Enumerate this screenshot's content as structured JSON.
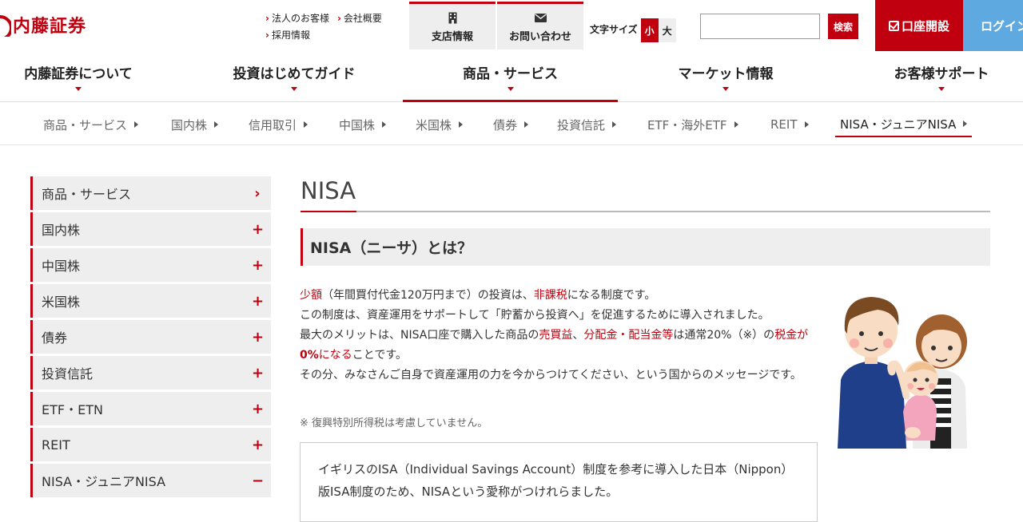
{
  "brand": {
    "name": "内藤証券"
  },
  "header": {
    "links": [
      "法人のお客様",
      "会社概要",
      "採用情報"
    ],
    "branch_label": "支店情報",
    "contact_label": "お問い合わせ",
    "font_size_label": "文字サイズ",
    "font_small": "小",
    "font_large": "大",
    "search_value": "",
    "search_button": "検索",
    "open_account": "口座開設",
    "login": "ログイン"
  },
  "gnav": {
    "items": [
      "内藤証券について",
      "投資はじめてガイド",
      "商品・サービス",
      "マーケット情報",
      "お客様サポート"
    ],
    "active": "商品・サービス"
  },
  "subnav": {
    "items": [
      "商品・サービス",
      "国内株",
      "信用取引",
      "中国株",
      "米国株",
      "債券",
      "投資信託",
      "ETF・海外ETF",
      "REIT",
      "NISA・ジュニアNISA"
    ],
    "active": "NISA・ジュニアNISA"
  },
  "sidebar": {
    "items": [
      {
        "label": "商品・サービス",
        "symbol": "›"
      },
      {
        "label": "国内株",
        "symbol": "+"
      },
      {
        "label": "中国株",
        "symbol": "+"
      },
      {
        "label": "米国株",
        "symbol": "+"
      },
      {
        "label": "債券",
        "symbol": "+"
      },
      {
        "label": "投資信託",
        "symbol": "+"
      },
      {
        "label": "ETF・ETN",
        "symbol": "+"
      },
      {
        "label": "REIT",
        "symbol": "+"
      },
      {
        "label": "NISA・ジュニアNISA",
        "symbol": "−"
      }
    ]
  },
  "main": {
    "title": "NISA",
    "section_heading": "NISA（ニーサ）とは？",
    "p1": {
      "a": "少額",
      "b": "（年間買付代金120万円まで）の投資は、",
      "c": "非課税",
      "d": "になる制度です。"
    },
    "p2": "この制度は、資産運用をサポートして「貯蓄から投資へ」を促進するために導入されました。",
    "p3": {
      "a": "最大のメリットは、NISA口座で購入した商品の",
      "b": "売買益",
      "c": "、",
      "d": "分配金・配当金等",
      "e": "は通常20%（※）の",
      "f": "税金が",
      "g": "0%",
      "h": "になる",
      "i": "ことです。"
    },
    "p4": "その分、みなさんご自身で資産運用の力を今からつけてください、という国からのメッセージです。",
    "note": "※ 復興特別所得税は考慮していません。",
    "box_text": "イギリスのISA（Individual Savings Account）制度を参考に導入した日本（Nippon）版ISA制度のため、NISAという愛称がつけれらました。"
  },
  "colors": {
    "accent": "#c0000e",
    "login_bg": "#5ea9e0",
    "panel_bg": "#eeeeee"
  }
}
